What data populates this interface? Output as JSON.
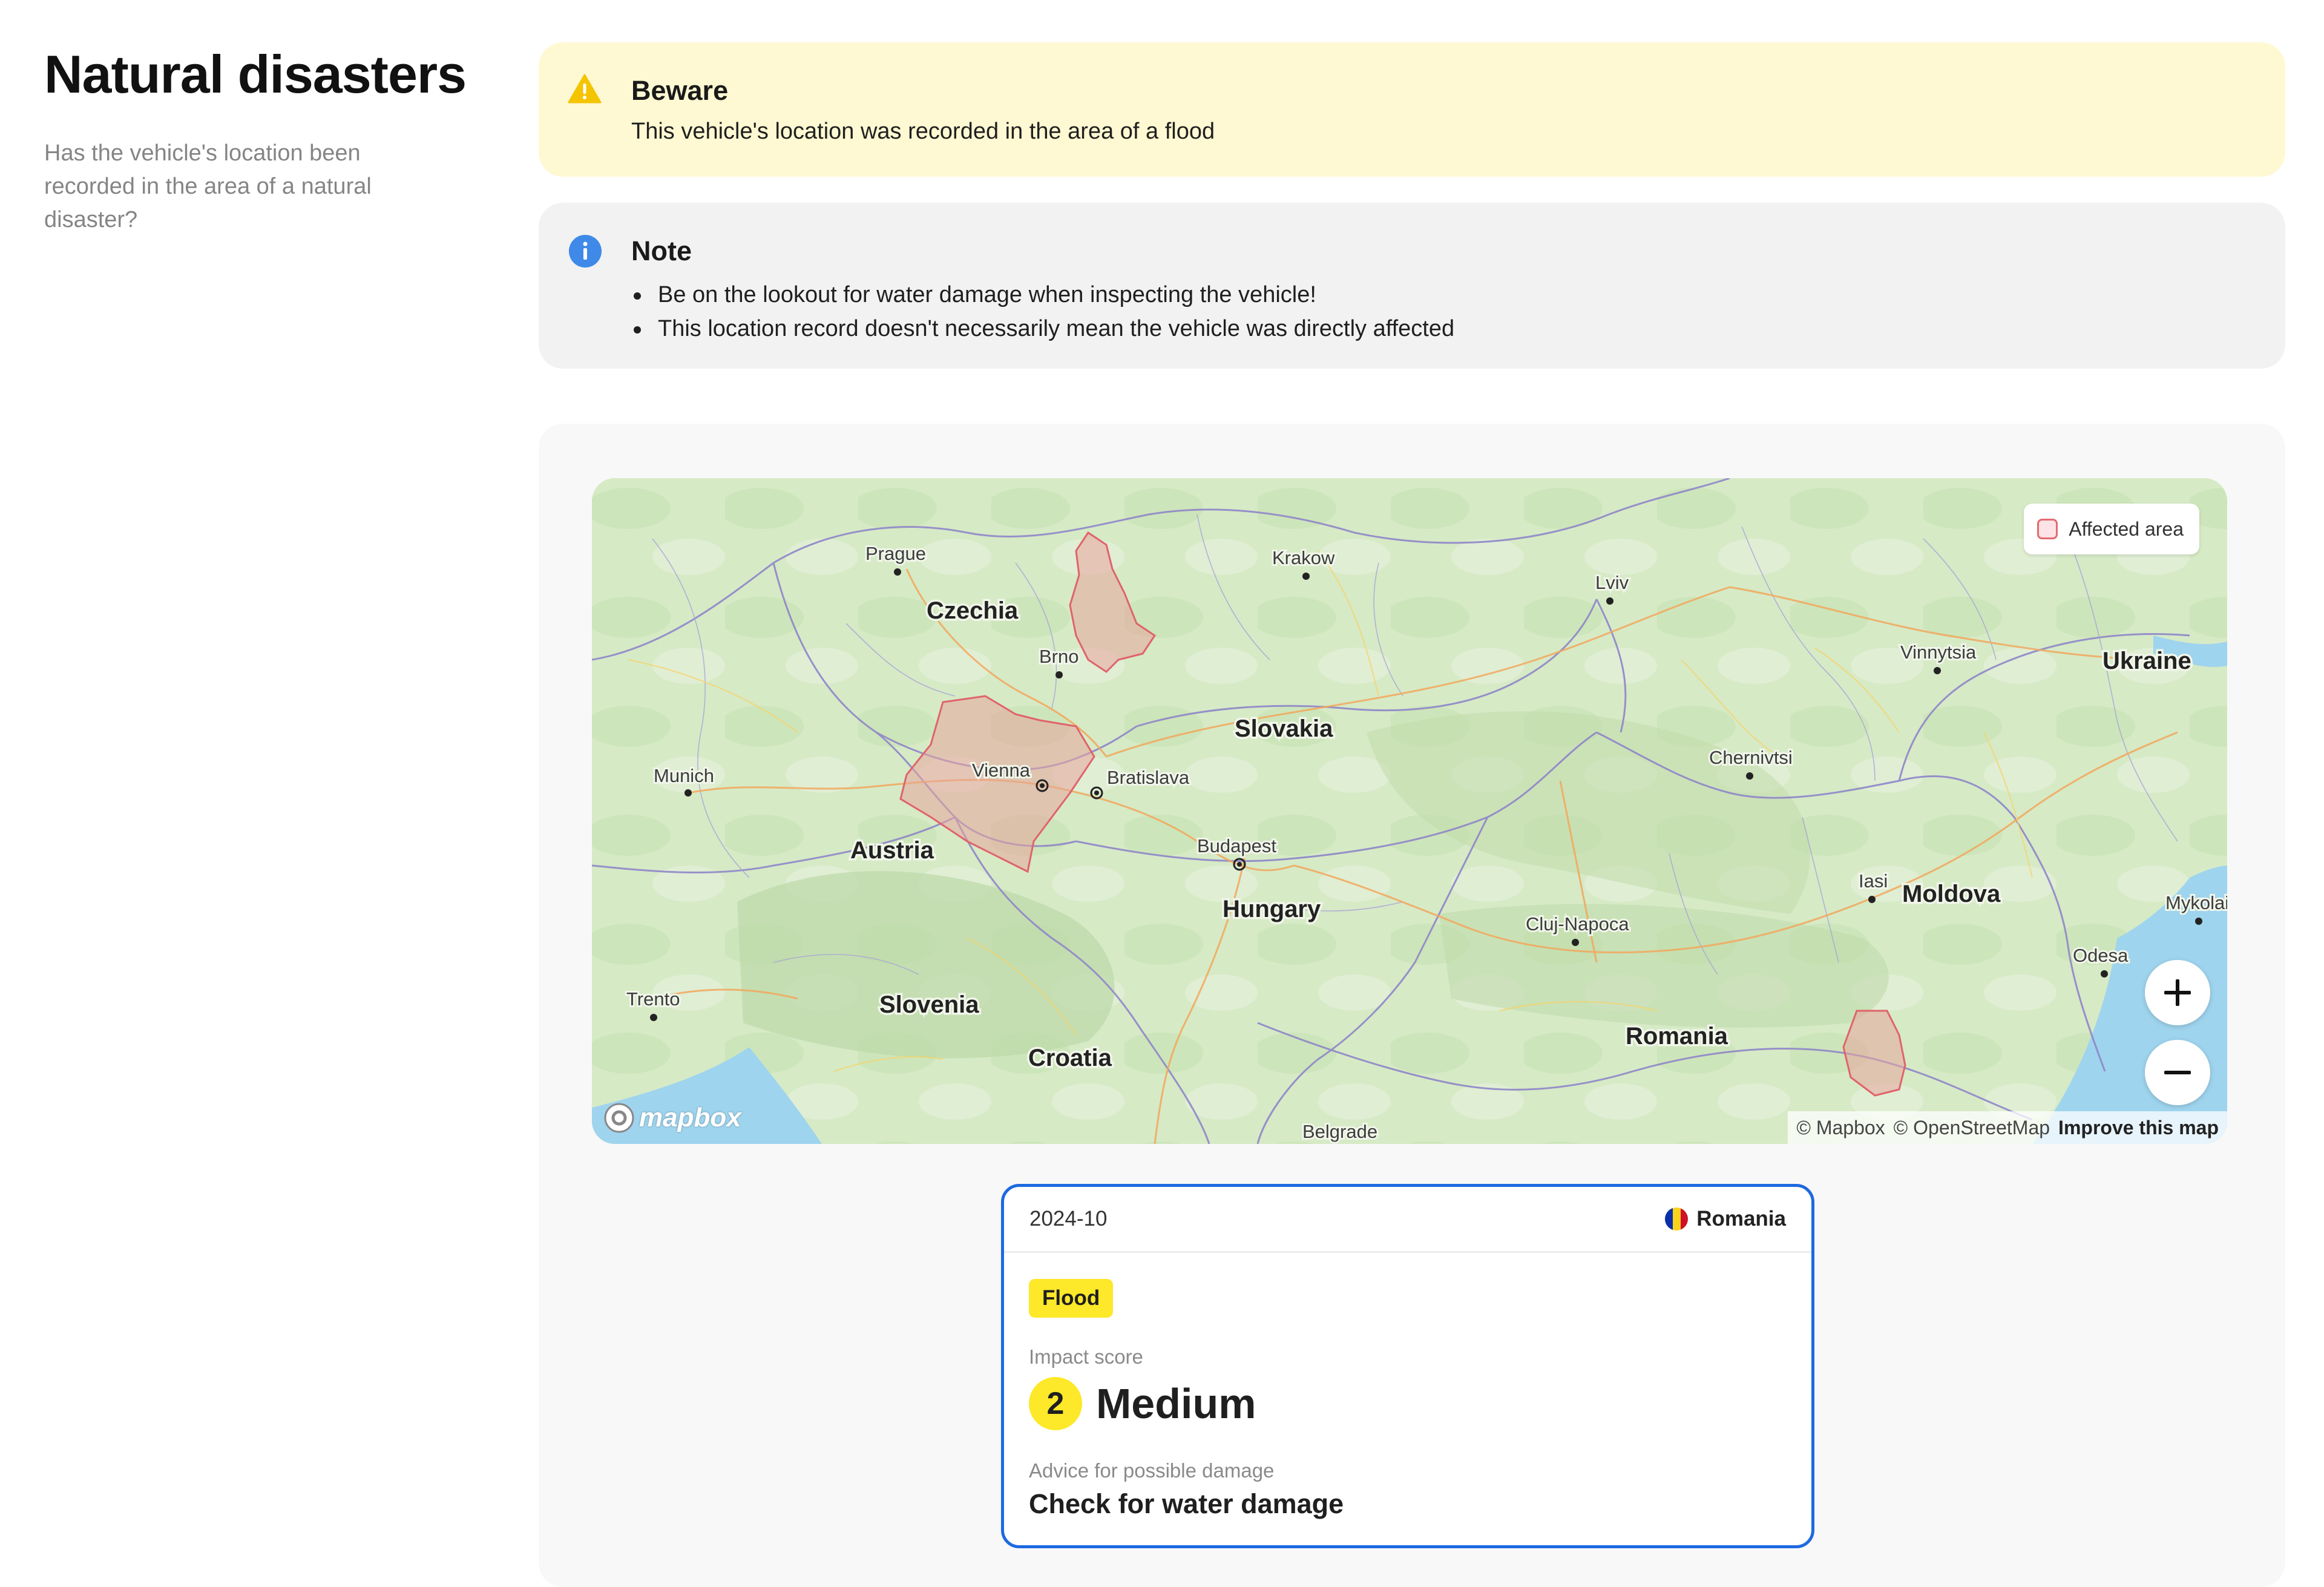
{
  "section": {
    "title": "Natural disasters",
    "subtitle": "Has the vehicle's location been recorded in the area of a natural disaster?"
  },
  "beware": {
    "title": "Beware",
    "text": "This vehicle's location was recorded in the area of a flood",
    "icon": "warning-icon",
    "color": "#fef9d2"
  },
  "note": {
    "title": "Note",
    "items": [
      "Be on the lookout for water damage when inspecting the vehicle!",
      "This location record doesn't necessarily mean the vehicle was directly affected"
    ],
    "icon": "info-icon",
    "color": "#f2f2f2"
  },
  "map": {
    "legend": "Affected area",
    "zoom_in_icon": "plus-icon",
    "zoom_out_icon": "minus-icon",
    "logo": "mapbox",
    "attribution": {
      "mapbox": "© Mapbox",
      "osm": "© OpenStreetMap",
      "improve": "Improve this map"
    },
    "countries": [
      "Czechia",
      "Slovakia",
      "Ukraine",
      "Austria",
      "Hungary",
      "Moldova",
      "Slovenia",
      "Croatia",
      "Romania"
    ],
    "cities": [
      "Prague",
      "Krakow",
      "Lviv",
      "Brno",
      "Vinnytsia",
      "Vienna",
      "Bratislava",
      "Munich",
      "Chernivtsi",
      "Budapest",
      "Iasi",
      "Mykolaiv",
      "Cluj-Napoca",
      "Odesa",
      "Trento",
      "Belgrade"
    ]
  },
  "event": {
    "date": "2024-10",
    "country": "Romania",
    "type": "Flood",
    "impact_label": "Impact score",
    "impact_score": "2",
    "impact_text": "Medium",
    "advice_label": "Advice for possible damage",
    "advice": "Check for water damage",
    "accent_color": "#1d6ae0",
    "badge_color": "#fde829"
  }
}
